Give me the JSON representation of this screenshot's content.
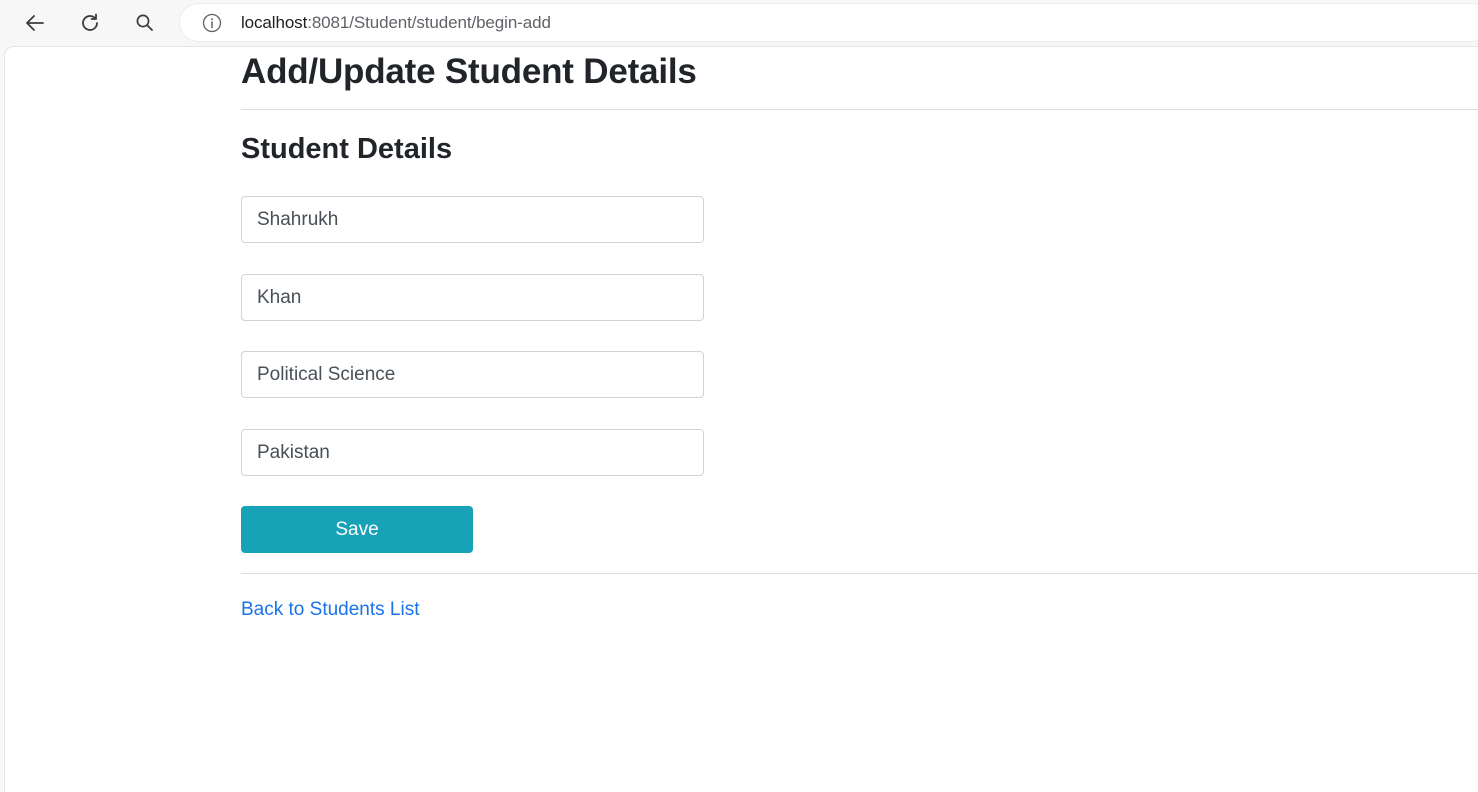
{
  "browser": {
    "url_host": "localhost",
    "url_rest": ":8081/Student/student/begin-add"
  },
  "page": {
    "title": "Add/Update Student Details",
    "section_title": "Student Details"
  },
  "form": {
    "first_name": "Shahrukh",
    "last_name": "Khan",
    "course": "Political Science",
    "country": "Pakistan",
    "save_label": "Save"
  },
  "links": {
    "back_label": "Back to Students List"
  },
  "colors": {
    "save_button": "#17a2b8",
    "link": "#1a73e8"
  },
  "icons": [
    "back-arrow-icon",
    "reload-icon",
    "search-icon",
    "info-icon"
  ]
}
